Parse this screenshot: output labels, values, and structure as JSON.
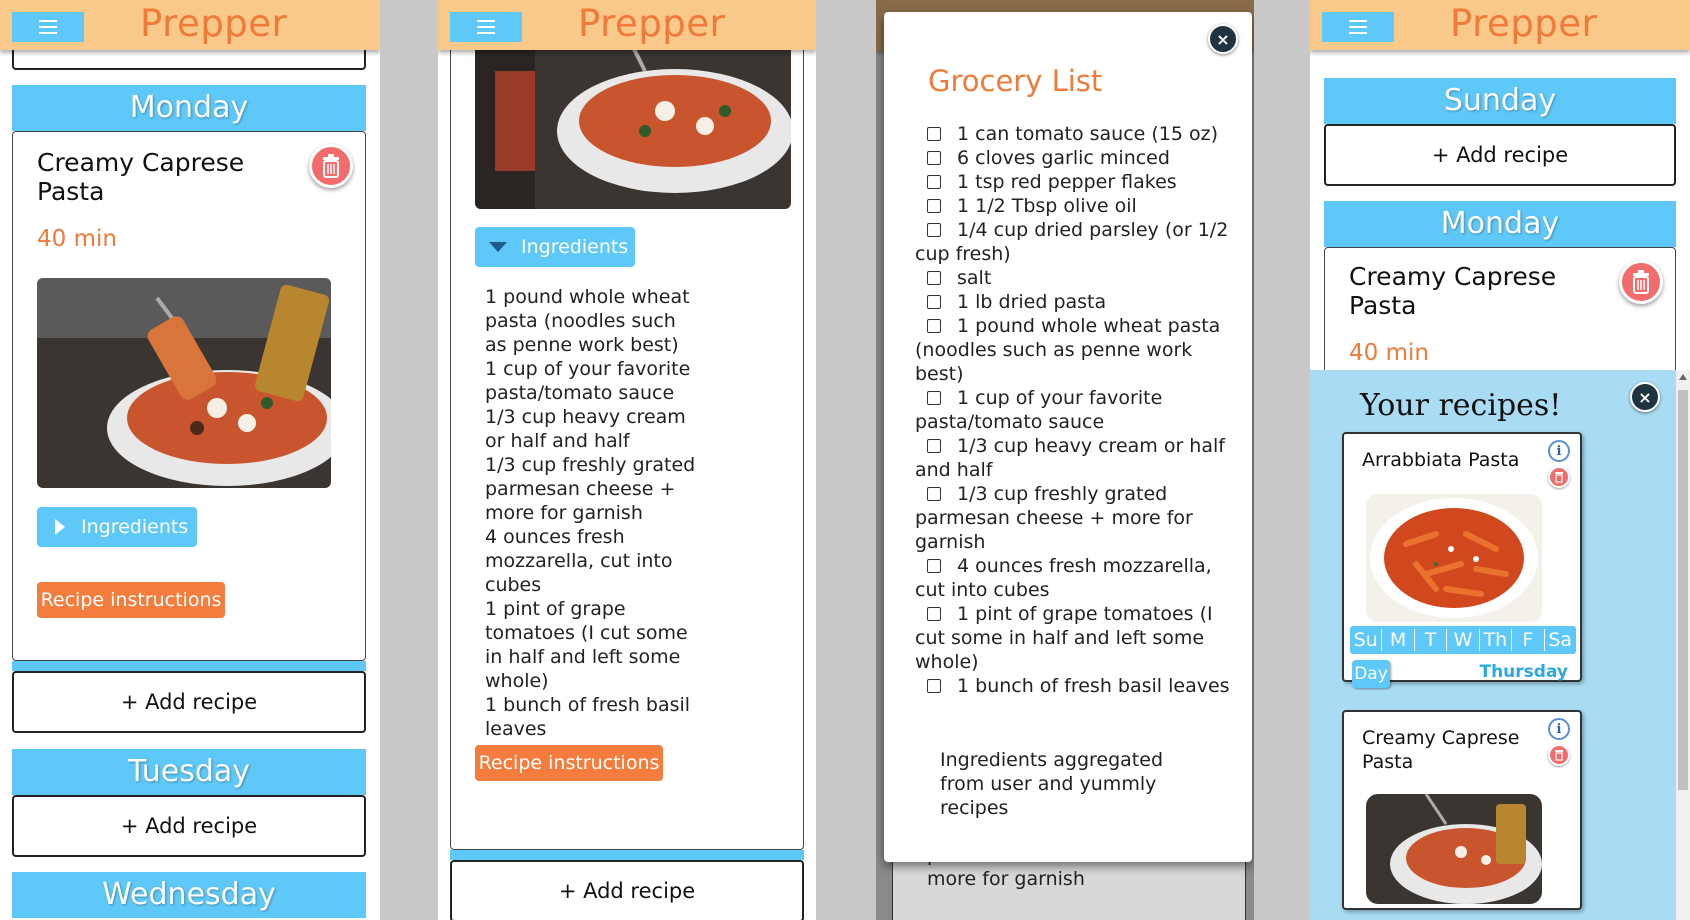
{
  "brand": "Prepper",
  "colors": {
    "accent_blue": "#5ec8f8",
    "accent_orange": "#f07a3a",
    "header_bg": "#f9c989",
    "drawer_bg": "#a9dcf3"
  },
  "icons": {
    "menu": "hamburger-icon",
    "trash": "trash-icon",
    "close": "close-icon",
    "info": "info-icon",
    "caret_right": "caret-right-icon",
    "caret_down": "caret-down-icon"
  },
  "panel1": {
    "day1": "Monday",
    "recipe_title": "Creamy Caprese Pasta",
    "time": "40 min",
    "ingredients_label": "Ingredients",
    "instructions_label": "Recipe instructions",
    "add_recipe": "+ Add recipe",
    "day2": "Tuesday",
    "add_recipe2": "+ Add recipe",
    "day3": "Wednesday"
  },
  "panel2": {
    "ingredients_label": "Ingredients",
    "ingredients": [
      "1 pound whole wheat pasta (noodles such as penne work best)",
      "1 cup of your favorite pasta/tomato sauce",
      "1/3 cup heavy cream or half and half",
      "1/3 cup freshly grated parmesan cheese + more for garnish",
      "4 ounces fresh mozzarella, cut into cubes",
      "1 pint of grape tomatoes (I cut some in half and left some whole)",
      "1 bunch of fresh basil leaves"
    ],
    "instructions_label": "Recipe instructions",
    "add_recipe": "+ Add recipe"
  },
  "panel3": {
    "title": "Grocery List",
    "close": "×",
    "items": [
      "1 can tomato sauce (15 oz)",
      "6 cloves garlic minced",
      "1 tsp red pepper flakes",
      "1 1/2 Tbsp olive oil",
      "1/4 cup dried parsley (or 1/2 cup fresh)",
      "salt",
      "1 lb dried pasta",
      "1 pound whole wheat pasta (noodles such as penne work best)",
      "1 cup of your favorite pasta/tomato sauce",
      "1/3 cup heavy cream or half and half",
      "1/3 cup freshly grated parmesan cheese + more for garnish",
      "4 ounces fresh mozzarella, cut into cubes",
      "1 pint of grape tomatoes (I cut some in half and left some whole)",
      "1 bunch of fresh basil leaves"
    ],
    "note": "Ingredients aggregated from user and yummly recipes",
    "behind_text": "parmesan cheese + more for garnish"
  },
  "panel4": {
    "day1": "Sunday",
    "add_recipe": "+ Add recipe",
    "day2": "Monday",
    "recipe_title": "Creamy Caprese Pasta",
    "time": "40 min",
    "drawer_title": "Your recipes!",
    "close": "×",
    "recipes": [
      {
        "title": "Arrabbiata Pasta",
        "days": [
          "Su",
          "M",
          "T",
          "W",
          "Th",
          "F",
          "Sa"
        ],
        "day_button": "Day",
        "selected_day": "Thursday"
      },
      {
        "title": "Creamy Caprese Pasta"
      }
    ]
  }
}
